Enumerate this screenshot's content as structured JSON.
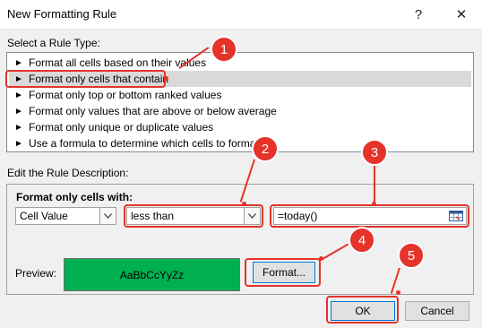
{
  "window": {
    "title": "New Formatting Rule",
    "help_glyph": "?",
    "close_glyph": "✕"
  },
  "rule_type": {
    "label": "Select a Rule Type:",
    "items": [
      {
        "label": "Format all cells based on their values"
      },
      {
        "label": "Format only cells that contain"
      },
      {
        "label": "Format only top or bottom ranked values"
      },
      {
        "label": "Format only values that are above or below average"
      },
      {
        "label": "Format only unique or duplicate values"
      },
      {
        "label": "Use a formula to determine which cells to format"
      }
    ],
    "selected_index": 1,
    "item_glyph": "►"
  },
  "description": {
    "label": "Edit the Rule Description:",
    "format_only_label": "Format only cells with:",
    "cell_value": "Cell Value",
    "operator": "less than",
    "formula": "=today()",
    "preview_label": "Preview:",
    "preview_text": "AaBbCcYyZz",
    "preview_color": "#00b050",
    "format_button": "Format..."
  },
  "buttons": {
    "ok": "OK",
    "cancel": "Cancel"
  },
  "callouts": [
    "1",
    "2",
    "3",
    "4",
    "5"
  ],
  "accent_color": "#e5332a"
}
